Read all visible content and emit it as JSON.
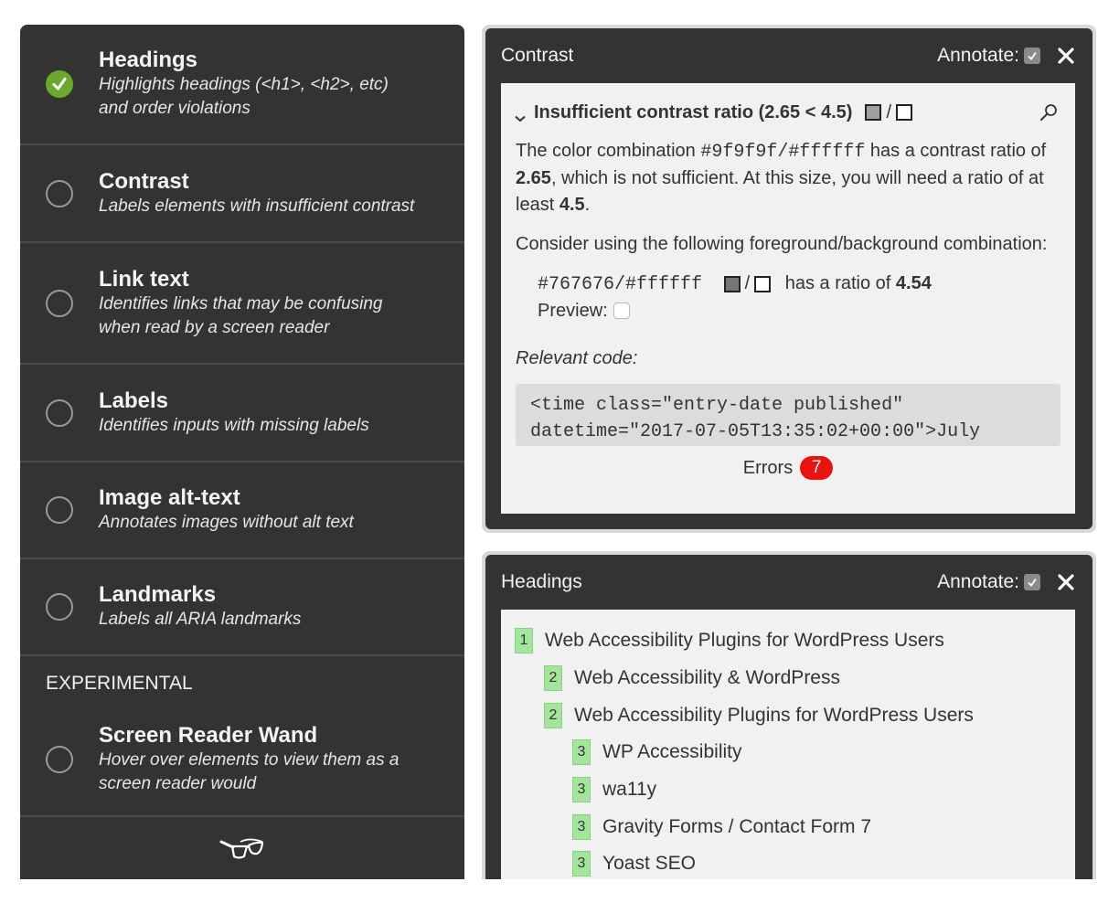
{
  "menu": {
    "items": [
      {
        "title": "Headings",
        "desc_lines": [
          "Highlights headings (<h1>, <h2>, etc)",
          "and order violations"
        ],
        "checked": true
      },
      {
        "title": "Contrast",
        "desc_lines": [
          "Labels elements with insufficient contrast"
        ],
        "checked": false
      },
      {
        "title": "Link text",
        "desc_lines": [
          "Identifies links that may be confusing",
          "when read by a screen reader"
        ],
        "checked": false
      },
      {
        "title": "Labels",
        "desc_lines": [
          "Identifies inputs with missing labels"
        ],
        "checked": false
      },
      {
        "title": "Image alt-text",
        "desc_lines": [
          "Annotates images without alt text"
        ],
        "checked": false
      },
      {
        "title": "Landmarks",
        "desc_lines": [
          "Labels all ARIA landmarks"
        ],
        "checked": false
      }
    ],
    "section_label": "EXPERIMENTAL",
    "experimental": [
      {
        "title": "Screen Reader Wand",
        "desc_lines": [
          "Hover over elements to view them as a",
          "screen reader would"
        ],
        "checked": false
      }
    ],
    "footer_icon": "glasses-icon",
    "check_color": "#6aa82e"
  },
  "contrast_panel": {
    "title": "Contrast",
    "annotate_label": "Annotate:",
    "annotate_checked": true,
    "issue_title": "Insufficient contrast ratio (2.65 < 4.5)",
    "issue_fg": "#9f9f9f",
    "issue_bg": "#ffffff",
    "para1": {
      "t1": "The color combination ",
      "code": "#9f9f9f/#ffffff",
      "t2": " has a contrast ratio of ",
      "ratio": "2.65",
      "t3": ", which is not sufficient. At this size, you will need a ratio of at least ",
      "required": "4.5",
      "t4": "."
    },
    "para2": "Consider using the following foreground/background combination:",
    "suggestion": {
      "code": "#767676/#ffffff",
      "fg": "#767676",
      "bg": "#ffffff",
      "ratio_text": "has a ratio of ",
      "ratio": "4.54",
      "preview_label": "Preview:",
      "preview_checked": false
    },
    "relevant_label": "Relevant code:",
    "code_lines": [
      "<time class=\"entry-date published\"",
      "datetime=\"2017-07-05T13:35:02+00:00\">July"
    ],
    "errors_label": "Errors",
    "errors_count": "7",
    "error_color": "#e8120f"
  },
  "headings_panel": {
    "title": "Headings",
    "annotate_label": "Annotate:",
    "annotate_checked": true,
    "items": [
      {
        "level": "1",
        "text": "Web Accessibility Plugins for WordPress Users"
      },
      {
        "level": "2",
        "text": "Web Accessibility & WordPress"
      },
      {
        "level": "2",
        "text": "Web Accessibility Plugins for WordPress Users"
      },
      {
        "level": "3",
        "text": "WP Accessibility"
      },
      {
        "level": "3",
        "text": "wa11y"
      },
      {
        "level": "3",
        "text": "Gravity Forms / Contact Form 7"
      },
      {
        "level": "3",
        "text": "Yoast SEO"
      }
    ],
    "level_badge_color": "#a3e59b"
  }
}
